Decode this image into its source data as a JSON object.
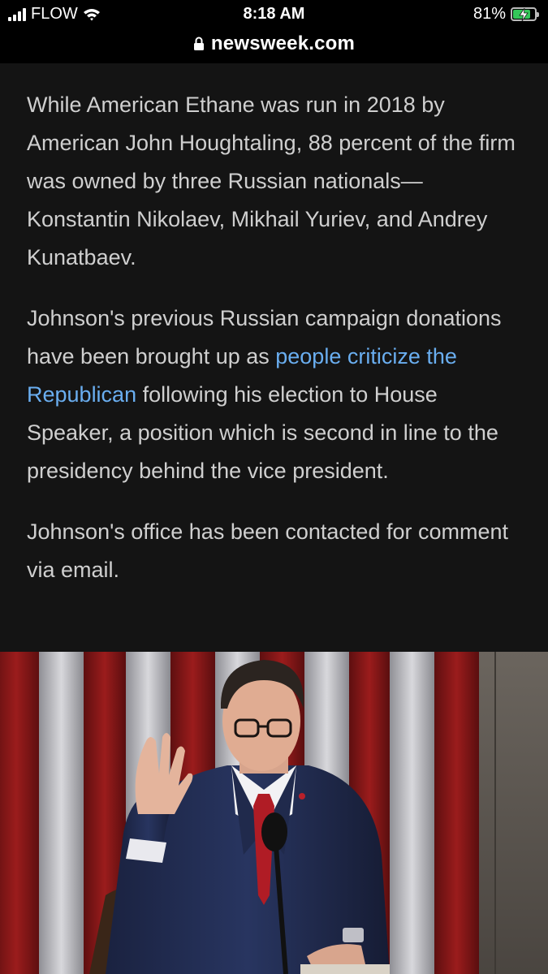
{
  "status_bar": {
    "carrier": "FLOW",
    "time": "8:18 AM",
    "battery_percent": "81%",
    "battery_level": 0.81,
    "signal_icon": "cellular-signal-icon",
    "wifi_icon": "wifi-icon",
    "battery_icon": "battery-charging-icon"
  },
  "url_bar": {
    "domain": "newsweek.com",
    "lock_icon": "lock-icon"
  },
  "article": {
    "paragraph_1": "While American Ethane was run in 2018 by American John Houghtaling, 88 percent of the firm was owned by three Russian nationals—Konstantin Nikolaev, Mikhail Yuriev, and Andrey Kunatbaev.",
    "paragraph_2_before": "Johnson's previous Russian campaign donations have been brought up as ",
    "paragraph_2_link": "people criticize the Republican",
    "paragraph_2_after": " following his election to House Speaker, a position which is second in line to the presidency behind the vice president.",
    "paragraph_3": "Johnson's office has been contacted for comment via email."
  },
  "colors": {
    "page_background": "#141414",
    "body_text": "#cfcfcf",
    "link": "#6aaef0",
    "battery_green": "#34c759"
  }
}
